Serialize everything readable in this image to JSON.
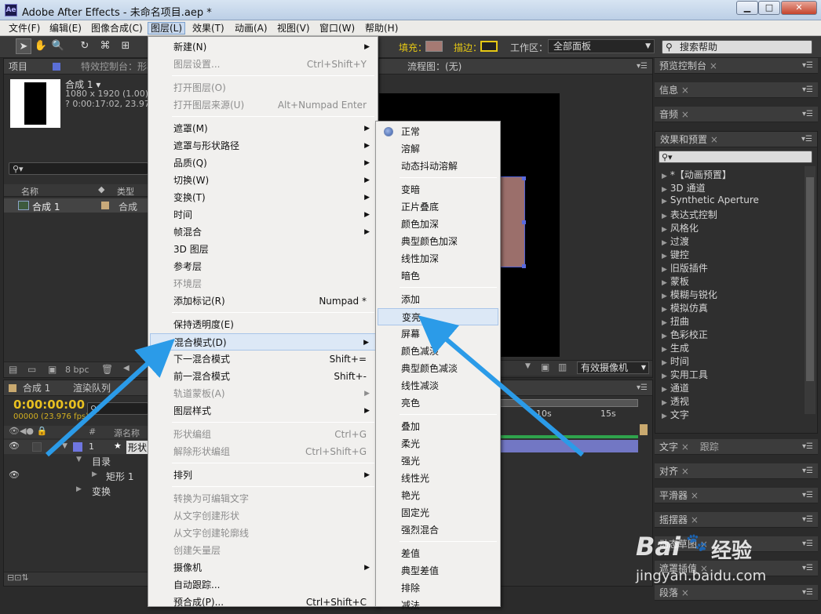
{
  "window": {
    "title": "Adobe After Effects - 未命名项目.aep *",
    "logo": "Ae",
    "min": "▁",
    "max": "□",
    "close": "✕"
  },
  "menubar": [
    "文件(F)",
    "编辑(E)",
    "图像合成(C)",
    "图层(L)",
    "效果(T)",
    "动画(A)",
    "视图(V)",
    "窗口(W)",
    "帮助(H)"
  ],
  "toolbar": {
    "fill_label": "填充：",
    "stroke_label": "描边：",
    "workspace_label": "工作区：",
    "workspace_value": "全部面板",
    "search_placeholder": "搜索帮助",
    "fill_color": "#a57a73",
    "stroke_color": "#e6c814"
  },
  "project": {
    "tab_label": "项目",
    "tab2_label": "特效控制台：形状",
    "comp_name": "合成 1 ▾",
    "comp_size": "1080 x 1920 (1.00)",
    "comp_duration": "? 0:00:17:02, 23.976",
    "col_name": "名称",
    "col_type": "类型",
    "item_name": "合成 1",
    "item_type": "合成",
    "bpc": "8 bpc"
  },
  "viewer": {
    "tab": "流程图：(无)",
    "camera": "有效摄像机",
    "layer_color": "#9b6f6b"
  },
  "timeline": {
    "tab1": "合成 1",
    "tab2": "渲染队列",
    "timecode": "0:00:00:00",
    "frames": "00000 (23.976 fps)",
    "col_source": "源名称",
    "layer_num": "1",
    "layer_name": "形状",
    "sub_contents": "目录",
    "sub_rect": "矩形 1",
    "sub_transform": "变换",
    "ruler": [
      "10s",
      "15s"
    ]
  },
  "right_panels": {
    "preview": "预览控制台",
    "info": "信息",
    "audio": "音频",
    "effects": "效果和预置",
    "text": "文字",
    "tracker": "跟踪",
    "align": "对齐",
    "smoother": "平滑器",
    "wiggler": "摇摆器",
    "motion_sketch": "动态草图",
    "mask_interp": "遮罩插值",
    "paragraph": "段落"
  },
  "effects_list": [
    "*【动画预置】",
    "3D 通道",
    "Synthetic Aperture",
    "表达式控制",
    "风格化",
    "过渡",
    "键控",
    "旧版插件",
    "蒙板",
    "模糊与锐化",
    "模拟仿真",
    "扭曲",
    "色彩校正",
    "生成",
    "时间",
    "实用工具",
    "通道",
    "透视",
    "文字"
  ],
  "layer_menu": [
    {
      "label": "新建(N)",
      "arrow": true
    },
    {
      "label": "图层设置...",
      "sc": "Ctrl+Shift+Y",
      "dis": true
    },
    {
      "sep": true
    },
    {
      "label": "打开图层(O)",
      "dis": true
    },
    {
      "label": "打开图层来源(U)",
      "sc": "Alt+Numpad Enter",
      "dis": true
    },
    {
      "sep": true
    },
    {
      "label": "遮罩(M)",
      "arrow": true
    },
    {
      "label": "遮罩与形状路径",
      "arrow": true
    },
    {
      "label": "品质(Q)",
      "arrow": true
    },
    {
      "label": "切换(W)",
      "arrow": true
    },
    {
      "label": "变换(T)",
      "arrow": true
    },
    {
      "label": "时间",
      "arrow": true
    },
    {
      "label": "帧混合",
      "arrow": true
    },
    {
      "label": "3D 图层"
    },
    {
      "label": "参考层"
    },
    {
      "label": "环境层",
      "dis": true
    },
    {
      "label": "添加标记(R)",
      "sc": "Numpad *"
    },
    {
      "sep": true
    },
    {
      "label": "保持透明度(E)"
    },
    {
      "label": "混合模式(D)",
      "arrow": true,
      "hl": true
    },
    {
      "label": "下一混合模式",
      "sc": "Shift+="
    },
    {
      "label": "前一混合模式",
      "sc": "Shift+-"
    },
    {
      "label": "轨道蒙板(A)",
      "arrow": true,
      "dis": true
    },
    {
      "label": "图层样式",
      "arrow": true
    },
    {
      "sep": true
    },
    {
      "label": "形状编组",
      "sc": "Ctrl+G",
      "dis": true
    },
    {
      "label": "解除形状编组",
      "sc": "Ctrl+Shift+G",
      "dis": true
    },
    {
      "sep": true
    },
    {
      "label": "排列",
      "arrow": true
    },
    {
      "sep": true
    },
    {
      "label": "转换为可编辑文字",
      "dis": true
    },
    {
      "label": "从文字创建形状",
      "dis": true
    },
    {
      "label": "从文字创建轮廓线",
      "dis": true
    },
    {
      "label": "创建矢量层",
      "dis": true
    },
    {
      "label": "摄像机",
      "arrow": true
    },
    {
      "label": "自动跟踪..."
    },
    {
      "label": "预合成(P)...",
      "sc": "Ctrl+Shift+C"
    }
  ],
  "blend_menu": [
    {
      "label": "正常",
      "sel": true
    },
    {
      "label": "溶解"
    },
    {
      "label": "动态抖动溶解"
    },
    {
      "sep": true
    },
    {
      "label": "变暗"
    },
    {
      "label": "正片叠底"
    },
    {
      "label": "颜色加深"
    },
    {
      "label": "典型颜色加深"
    },
    {
      "label": "线性加深"
    },
    {
      "label": "暗色"
    },
    {
      "sep": true
    },
    {
      "label": "添加"
    },
    {
      "label": "变亮",
      "hl": true
    },
    {
      "label": "屏幕"
    },
    {
      "label": "颜色减淡"
    },
    {
      "label": "典型颜色减淡"
    },
    {
      "label": "线性减淡"
    },
    {
      "label": "亮色"
    },
    {
      "sep": true
    },
    {
      "label": "叠加"
    },
    {
      "label": "柔光"
    },
    {
      "label": "强光"
    },
    {
      "label": "线性光"
    },
    {
      "label": "艳光"
    },
    {
      "label": "固定光"
    },
    {
      "label": "强烈混合"
    },
    {
      "sep": true
    },
    {
      "label": "差值"
    },
    {
      "label": "典型差值"
    },
    {
      "label": "排除"
    },
    {
      "label": "减法"
    }
  ],
  "watermark": {
    "brand": "Bai",
    "brand2": "经验",
    "url": "jingyan.baidu.com"
  }
}
